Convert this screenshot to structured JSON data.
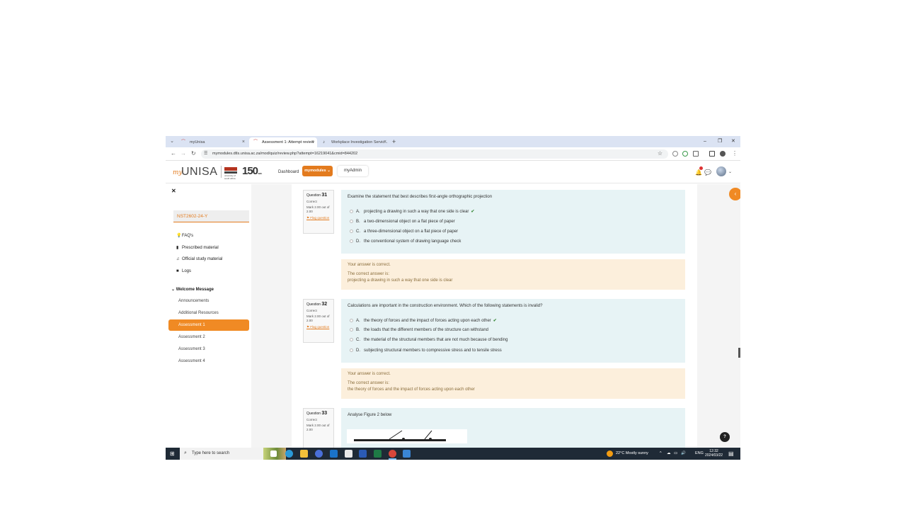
{
  "browser": {
    "tabs": [
      {
        "label": "myUnisa",
        "active": false
      },
      {
        "label": "Assessment 1: Attempt review",
        "active": true
      },
      {
        "label": "Workplace Investigation Servic...",
        "active": false
      }
    ],
    "new_tab": "+",
    "url": "mymodules.dtls.unisa.ac.za/mod/quiz/review.php?attempt=16219041&cmid=844202",
    "window_controls": [
      "–",
      "❐",
      "✕"
    ]
  },
  "header": {
    "logo_my": "my",
    "logo_unisa": "UNISA",
    "logo_crest_text": "university of south africa",
    "logo_150": "150",
    "logo_150_sub": "YEARS",
    "nav": {
      "dashboard": "Dashboard",
      "mymodules": "mymodules ⌄",
      "myadmin": "myAdmin"
    }
  },
  "drawer": {
    "close": "✕",
    "course_code": "NST2602-24-Y",
    "items": [
      {
        "icon": "lightbulb-icon",
        "glyph": "💡",
        "label": "FAQ's"
      },
      {
        "icon": "bookmark-icon",
        "glyph": "🔖",
        "label": "Prescribed material"
      },
      {
        "icon": "music-note-icon",
        "glyph": "♫",
        "label": "Official study material"
      },
      {
        "icon": "folder-icon",
        "glyph": "■",
        "label": "Logs"
      }
    ],
    "section": "Welcome Message",
    "sub_items": [
      "Announcements",
      "Additional Resources",
      "Assessment 1",
      "Assessment 2",
      "Assessment 3",
      "Assessment 4"
    ]
  },
  "questions": [
    {
      "number_prefix": "Question",
      "number": "31",
      "state": "Correct",
      "mark": "Mark 2.00 out of 2.00",
      "flag": "Flag question",
      "text": "Examine the statement that best describes first-angle orthographic projection",
      "options": [
        {
          "letter": "A.",
          "text": "projecting a drawing in such a way that one side is clear",
          "correct": "✔"
        },
        {
          "letter": "B.",
          "text": "a two-dimensional object on a flat piece of paper",
          "correct": ""
        },
        {
          "letter": "C.",
          "text": "a three-dimensional object on a flat piece of paper",
          "correct": ""
        },
        {
          "letter": "D.",
          "text": "the conventional system of drawing language check",
          "correct": ""
        }
      ],
      "feedback": {
        "status": "Your answer is correct.",
        "label": "The correct answer is:",
        "answer": "projecting a drawing in such a way that one side is clear"
      }
    },
    {
      "number_prefix": "Question",
      "number": "32",
      "state": "Correct",
      "mark": "Mark 2.00 out of 2.00",
      "flag": "Flag question",
      "text": "Calculations are important in the construction environment. Which of the following statements is invalid?",
      "options": [
        {
          "letter": "A.",
          "text": "the theory of forces and the impact of forces acting upon each other",
          "correct": "✔"
        },
        {
          "letter": "B.",
          "text": "the loads that the different members of the structure can withstand",
          "correct": ""
        },
        {
          "letter": "C.",
          "text": "the material of the structural members that are not much because of bending",
          "correct": ""
        },
        {
          "letter": "D.",
          "text": "subjecting structural members to compressive stress and to tensile stress",
          "correct": ""
        }
      ],
      "feedback": {
        "status": "Your answer is correct.",
        "label": "The correct answer is:",
        "answer": "the theory of forces and the impact of forces acting upon each other"
      }
    },
    {
      "number_prefix": "Question",
      "number": "33",
      "state": "Correct",
      "mark": "Mark 2.00 out of 2.00",
      "text": "Analyse Figure 2 below"
    }
  ],
  "controls": {
    "collapse": "‹",
    "help": "?"
  },
  "taskbar": {
    "search_placeholder": "Type here to search",
    "weather": "22°C  Mostly sunny",
    "lang": "ENG",
    "time": "12:32",
    "date": "2024/03/22"
  },
  "colors": {
    "accent": "#f08a24",
    "question_bg": "#e7f3f5",
    "feedback_bg": "#fcefdc",
    "tab_strip": "#dbe3f3",
    "taskbar": "#1f2a36"
  }
}
